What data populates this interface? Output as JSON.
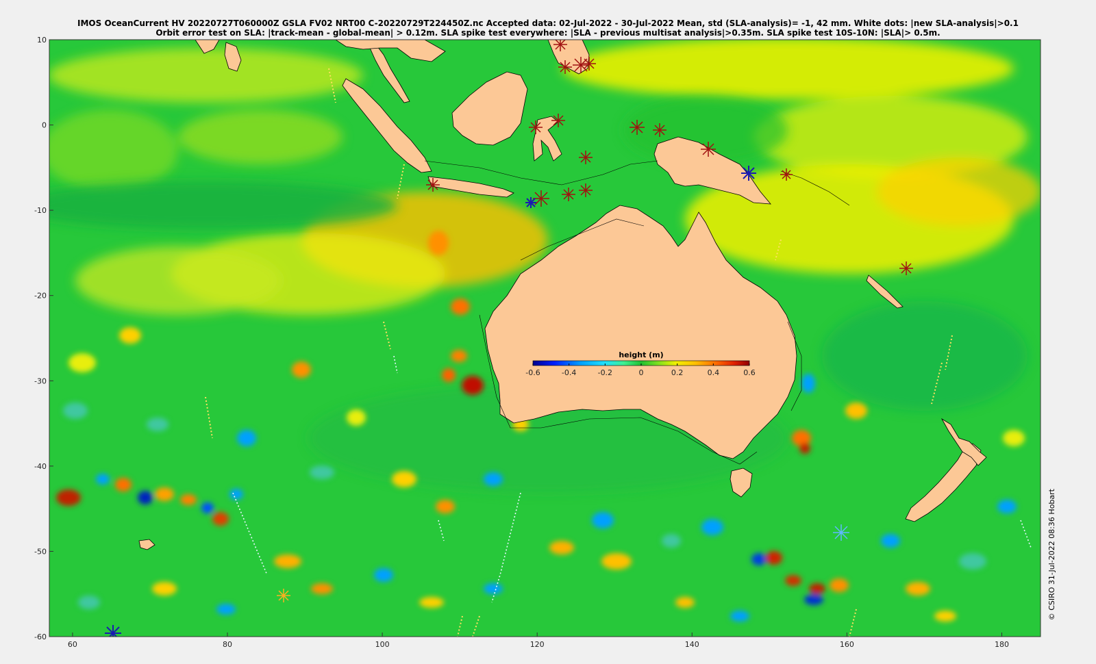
{
  "header": {
    "title_line1": "IMOS OceanCurrent HV 20220727T060000Z GSLA FV02 NRT00 C-20220729T224450Z.nc  Accepted data: 02-Jul-2022 - 30-Jul-2022 Mean, std (SLA-analysis)= -1, 42 mm. White dots: |new SLA-analysis|>0.1",
    "title_line2": "Orbit error test on SLA: |track-mean  - global-mean| > 0.12m.  SLA spike test everywhere: |SLA - previous multisat analysis|>0.35m. SLA spike test 10S-10N: |SLA|> 0.5m."
  },
  "map": {
    "x_axis": {
      "ticks": [
        "60",
        "80",
        "100",
        "120",
        "140",
        "160",
        "180"
      ],
      "range": [
        57,
        185
      ]
    },
    "y_axis": {
      "ticks": [
        "10",
        "0",
        "-10",
        "-20",
        "-30",
        "-40",
        "-50",
        "-60"
      ],
      "range": [
        -60,
        10
      ]
    },
    "land_color": "#fcc896",
    "ocean_base_color": "#27c83a"
  },
  "colorbar": {
    "title": "height (m)",
    "ticks": [
      "-0.6",
      "-0.4",
      "-0.2",
      "0",
      "0.2",
      "0.4",
      "0.6"
    ],
    "range": [
      -0.6,
      0.6
    ],
    "colormap": [
      "#00008f",
      "#0020ff",
      "#00a0ff",
      "#20e0ff",
      "#40f090",
      "#20c030",
      "#80e020",
      "#f0f000",
      "#ffc000",
      "#ff7000",
      "#e02000",
      "#900000"
    ]
  },
  "footer": {
    "credit": "© CSIRO 31-Jul-2022 08:36 Hobart"
  }
}
